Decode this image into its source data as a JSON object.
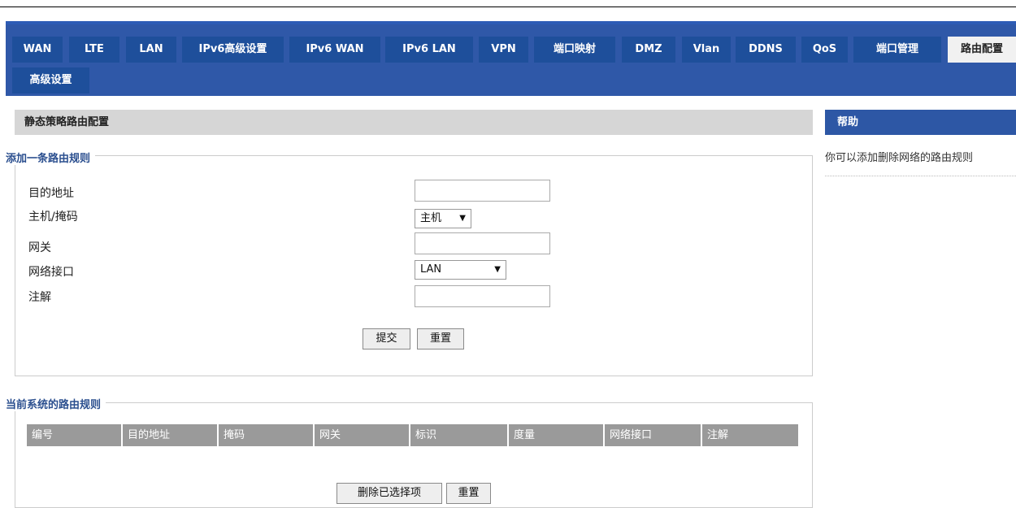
{
  "nav": {
    "tabs": [
      "WAN",
      "LTE",
      "LAN",
      "IPv6高级设置",
      "IPv6 WAN",
      "IPv6 LAN",
      "VPN",
      "端口映射",
      "DMZ",
      "Vlan",
      "DDNS",
      "QoS",
      "端口管理",
      "路由配置",
      "高级设置"
    ],
    "active": "路由配置"
  },
  "page": {
    "title": "静态策略路由配置"
  },
  "help": {
    "title": "帮助",
    "text": "你可以添加删除网络的路由规则"
  },
  "add_rule": {
    "legend": "添加一条路由规则",
    "labels": {
      "dest": "目的地址",
      "mask": "主机/掩码",
      "gateway": "网关",
      "iface": "网络接口",
      "comment": "注解"
    },
    "values": {
      "dest": "",
      "gateway": "",
      "comment": ""
    },
    "mask_select": "主机",
    "iface_select": "LAN",
    "submit_label": "提交",
    "reset_label": "重置"
  },
  "current_rules": {
    "legend": "当前系统的路由规则",
    "columns": [
      "编号",
      "目的地址",
      "掩码",
      "网关",
      "标识",
      "度量",
      "网络接口",
      "注解"
    ],
    "rows": [],
    "delete_label": "删除已选择项",
    "reset_label": "重置"
  },
  "icons": {
    "dropdown": "dropdown-arrow-icon"
  },
  "colors": {
    "nav_bg": "#2f58a8",
    "tab_bg": "#1e4f9b",
    "help_header": "#2d57a5",
    "legend_text": "#2b4f8f"
  }
}
